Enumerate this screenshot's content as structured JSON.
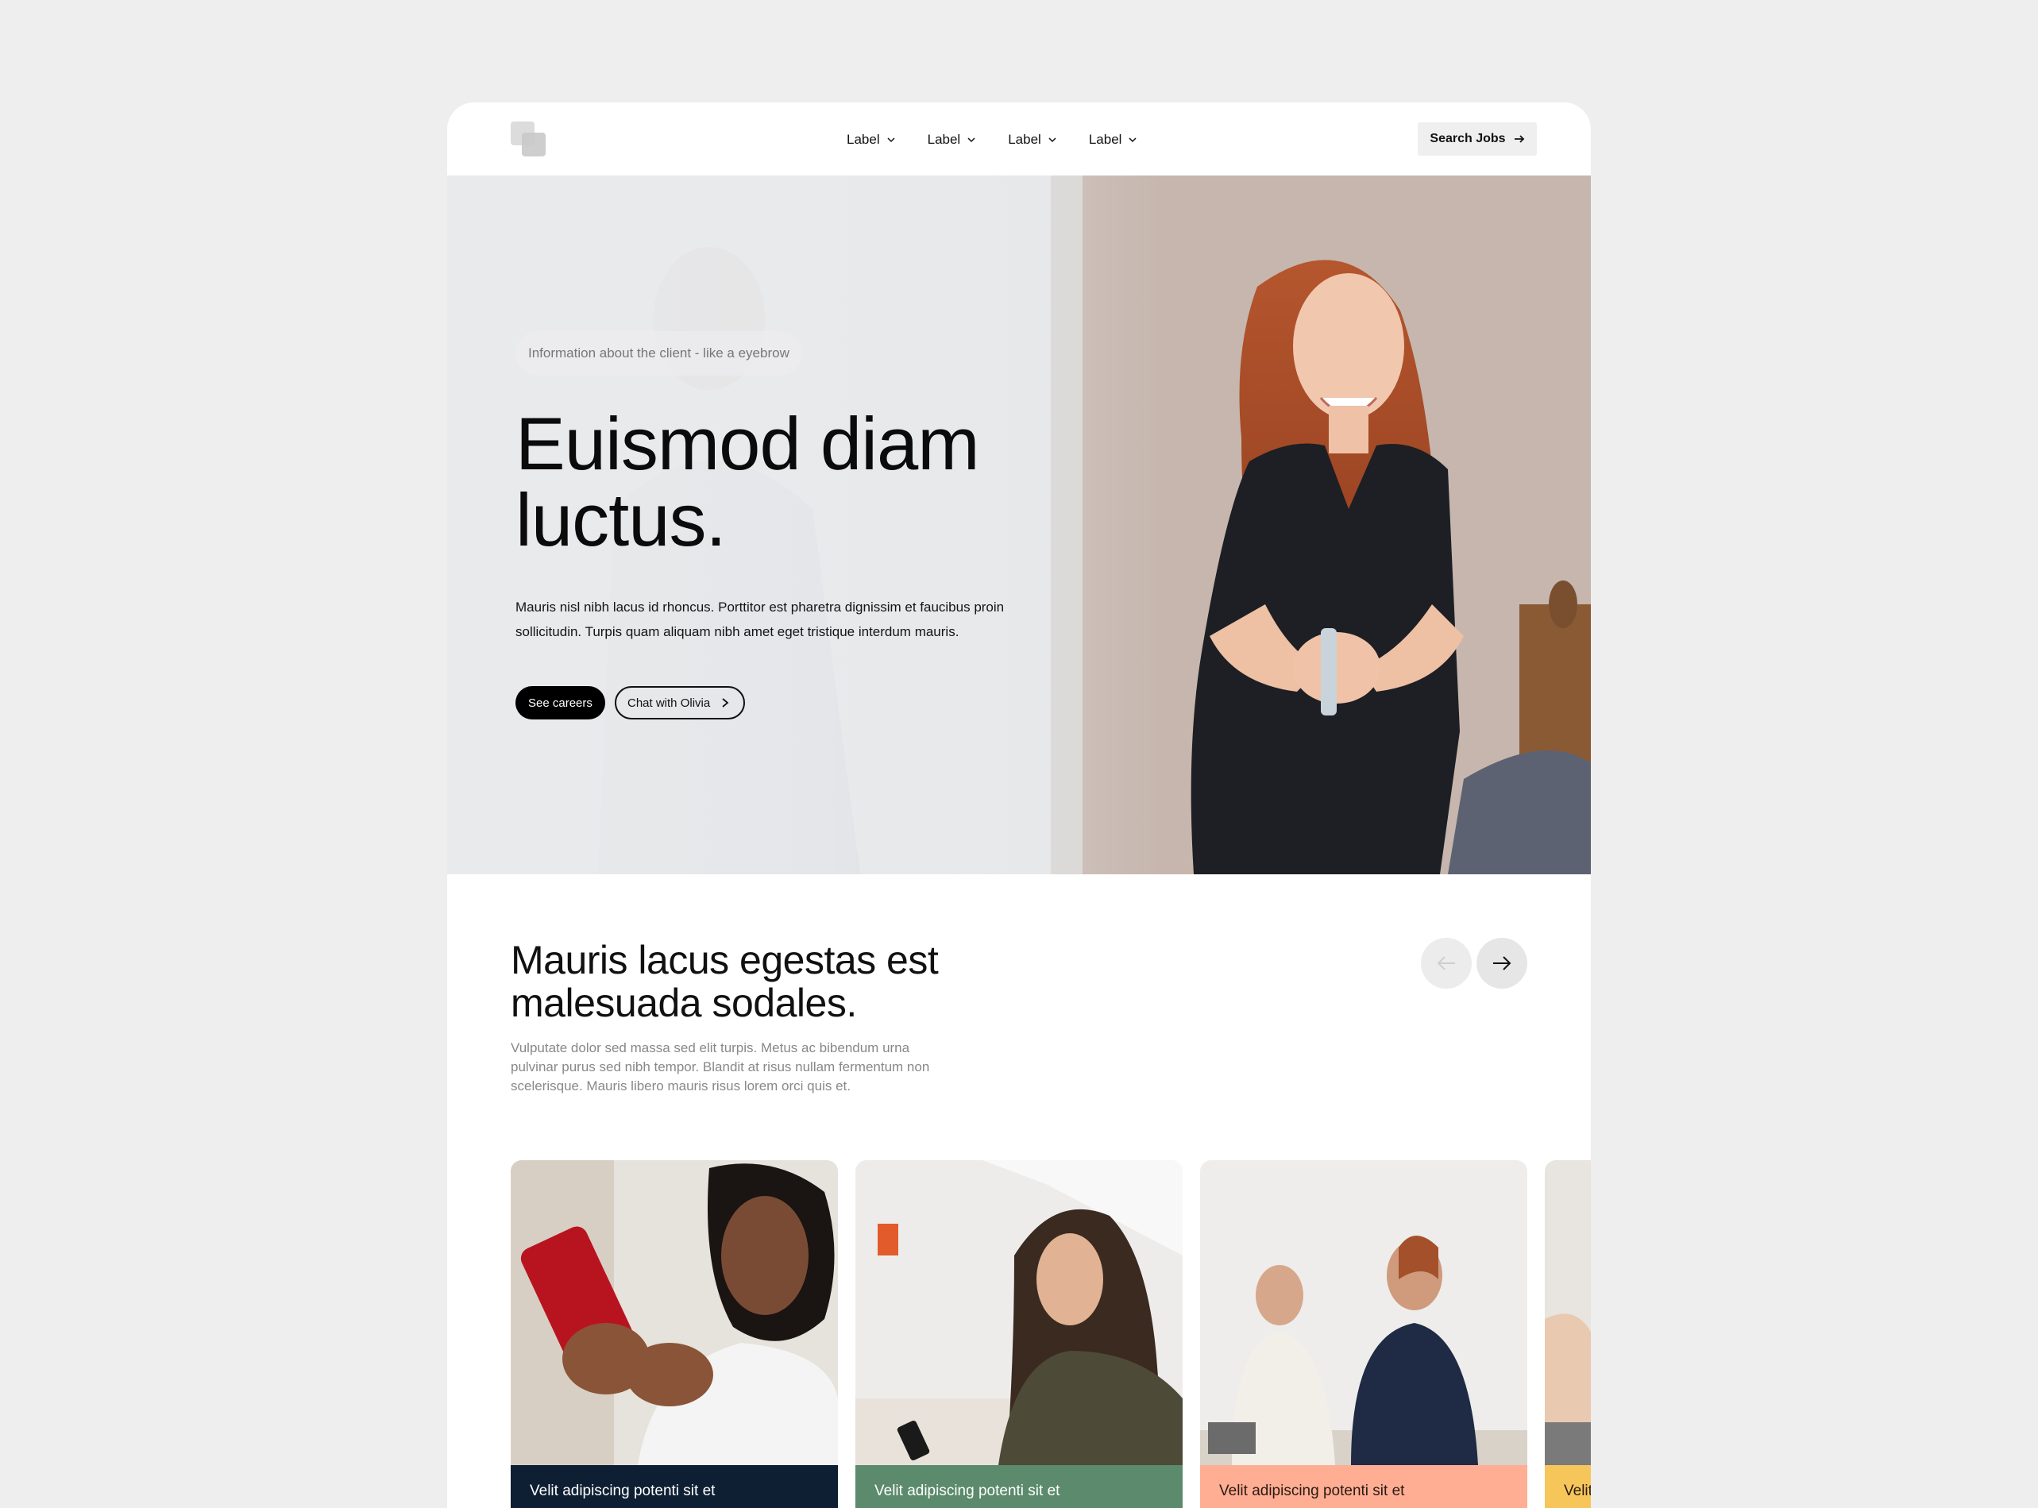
{
  "nav": {
    "items": [
      {
        "label": "Label"
      },
      {
        "label": "Label"
      },
      {
        "label": "Label"
      },
      {
        "label": "Label"
      }
    ],
    "cta_label": "Search Jobs"
  },
  "hero": {
    "eyebrow": "Information about the client - like a eyebrow",
    "title": "Euismod diam luctus.",
    "body": "Mauris nisl nibh lacus id rhoncus. Porttitor est pharetra dignissim et faucibus proin sollicitudin. Turpis quam aliquam nibh amet eget tristique interdum mauris.",
    "primary_button": "See careers",
    "secondary_button": "Chat with Olivia"
  },
  "section": {
    "title": "Mauris lacus egestas est malesuada sodales.",
    "body": "Vulputate dolor sed massa sed elit turpis. Metus ac bibendum urna pulvinar purus sed nibh tempor. Blandit at risus nullam fermentum non scelerisque. Mauris libero mauris risus lorem orci quis et."
  },
  "cards": [
    {
      "caption": "Velit adipiscing potenti sit et",
      "color": "#0f1f33"
    },
    {
      "caption": "Velit adipiscing potenti sit et",
      "color": "#5b8a6c"
    },
    {
      "caption": "Velit adipiscing potenti sit et",
      "color": "#ffae94"
    },
    {
      "caption": "Velit",
      "color": "#f7c65b"
    }
  ],
  "colors": {
    "page_background": "#eeeeee",
    "primary_button": "#000000"
  }
}
